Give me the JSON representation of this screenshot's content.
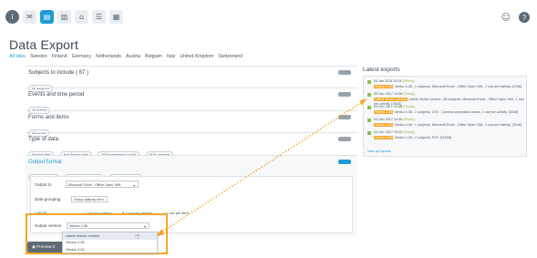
{
  "toolbar": {
    "icons": [
      "info-icon",
      "email-icon",
      "document-icon",
      "bar-chart-icon",
      "bank-icon",
      "list-icon",
      "table-icon"
    ],
    "right": {
      "user": "☺",
      "help": "?"
    }
  },
  "page": {
    "title": "Data Export"
  },
  "sites": [
    "All sites",
    "Sweden",
    "Finland",
    "Germany",
    "Netherlands",
    "Austria",
    "Belgium",
    "Italy",
    "United Kingdom",
    "Switzerland"
  ],
  "sections": {
    "subjects": {
      "title": "Subjects to include ( 87 )",
      "tags": [
        "All subjects"
      ]
    },
    "events": {
      "title": "Events and time period",
      "tags": [
        "All events"
      ]
    },
    "forms": {
      "title": "Forms and items",
      "tags": [
        "All forms"
      ]
    },
    "type": {
      "title": "Type of data",
      "tags": [
        "Signed data",
        "Not Signed data",
        "SDV performed on NA",
        "SDV pending"
      ]
    },
    "output": {
      "title": "Output format",
      "tags": [
        "Output to Excel",
        "Group data by Form",
        "1 row per activity"
      ],
      "output_to_label": "Output to",
      "output_to_value": "Microsoft Excel - Office Open XML",
      "grouping_label": "Data grouping",
      "grouping_value": "Group data by form",
      "layout_label": "Layout",
      "layout_options": [
        "1 row per subject",
        "1 row per activity",
        "1 row per item"
      ],
      "version_label": "Output version",
      "version_value": "Viedoc 4.38",
      "version_options": [
        "Latest Viedoc version",
        "Viedoc 4.38",
        "Viedoc 4.39"
      ]
    },
    "preview": {
      "label": "Preview d"
    }
  },
  "latest": {
    "title": "Latest exports",
    "items": [
      {
        "date": "09 Jan 2018 15:25",
        "status": "(Ready)",
        "text": "Viedoc 4.38 ; 1 subjects, Microsoft Excel - Office Open XML, 1 row per activity. [3768]",
        "hl": "Viedoc 4.38"
      },
      {
        "date": "05 Dec 2017 14:58",
        "status": "(Ready)",
        "text": "Latest Viedoc version ; 89 subjects, Microsoft Excel - Office Open XML, 1 row per activity. [7608]",
        "hl": "Latest Viedoc version"
      },
      {
        "date": "04 Dec 2017 10:38",
        "status": "(Ready)",
        "text": "Viedoc 4.38 ; 1 subjects, CSV - Comma separated values, 1 row per activity. [3048]",
        "hl": "Viedoc 4.38"
      },
      {
        "date": "04 Dec 2017 10:36",
        "status": "(Ready)",
        "text": "Viedoc 4.38 ; 1 subjects, Microsoft Excel - Office Open XML, 1 row per activity. [3048]",
        "hl": "Viedoc 4.38"
      },
      {
        "date": "04 Dec 2017 10:33",
        "status": "(Ready)",
        "text": "Viedoc 4.38 ; 2 subjects, PDF. [31908]",
        "hl": "Viedoc 4.38"
      }
    ],
    "view_all": "View all exports"
  },
  "colors": {
    "accent": "#1e9bd7",
    "highlight": "#f5a623",
    "ready": "#8ac24a"
  }
}
